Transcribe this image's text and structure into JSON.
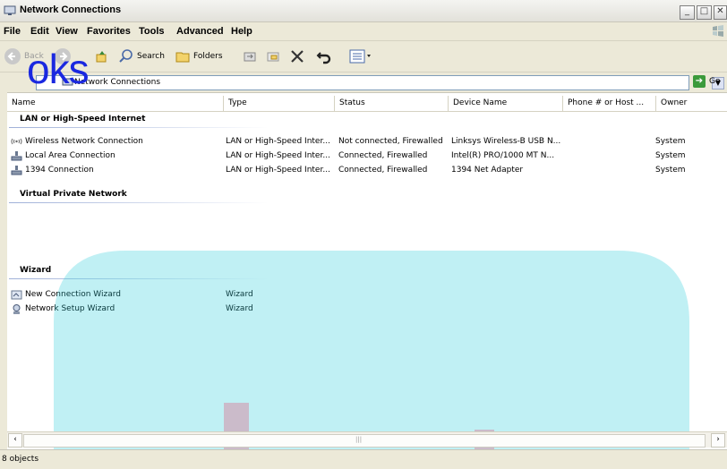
{
  "window": {
    "title": "Network Connections"
  },
  "menu": [
    "File",
    "Edit",
    "View",
    "Favorites",
    "Tools",
    "Advanced",
    "Help"
  ],
  "toolbar": {
    "back": "Back",
    "search": "Search",
    "folders": "Folders"
  },
  "address": {
    "value": "Network Connections",
    "go": "Go"
  },
  "columns": [
    "Name",
    "Type",
    "Status",
    "Device Name",
    "Phone # or Host ...",
    "Owner"
  ],
  "groups": {
    "lan": {
      "title": "LAN or High-Speed Internet",
      "rows": [
        {
          "name": "Wireless Network Connection",
          "type": "LAN or High-Speed Inter...",
          "status": "Not connected, Firewalled",
          "device": "Linksys Wireless-B USB N...",
          "phone": "",
          "owner": "System",
          "icon": "wireless-icon"
        },
        {
          "name": "Local Area Connection",
          "type": "LAN or High-Speed Inter...",
          "status": "Connected, Firewalled",
          "device": "Intel(R) PRO/1000 MT N...",
          "phone": "",
          "owner": "System",
          "icon": "network-icon"
        },
        {
          "name": "1394 Connection",
          "type": "LAN or High-Speed Inter...",
          "status": "Connected, Firewalled",
          "device": "1394 Net Adapter",
          "phone": "",
          "owner": "System",
          "icon": "network-icon"
        }
      ]
    },
    "vpn": {
      "title": "Virtual Private Network",
      "rows": []
    },
    "wizard": {
      "title": "Wizard",
      "rows": [
        {
          "name": "New Connection Wizard",
          "type": "Wizard",
          "icon": "wizard-icon"
        },
        {
          "name": "Network Setup Wizard",
          "type": "Wizard",
          "icon": "setup-wizard-icon"
        }
      ]
    }
  },
  "status": {
    "text": "8 objects"
  },
  "watermark": {
    "text": "oks"
  }
}
